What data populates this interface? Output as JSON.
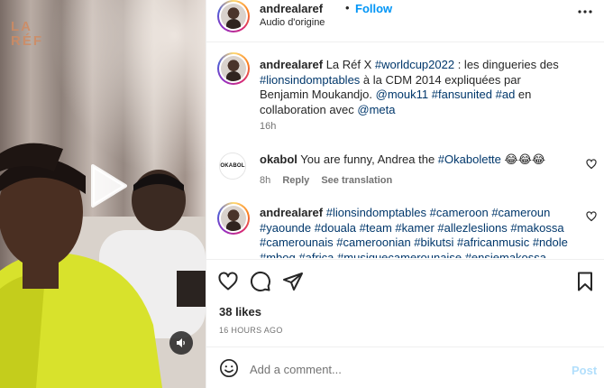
{
  "video": {
    "logo_line1": "LA",
    "logo_line2": "RÉF",
    "play_icon": "play-icon",
    "sound_icon": "speaker-icon"
  },
  "header": {
    "username": "andrealaref",
    "dot": "•",
    "follow_label": "Follow",
    "audio_label": "Audio d'origine",
    "more_icon": "more-horizontal-icon"
  },
  "caption": {
    "username": "andrealaref",
    "parts": [
      {
        "t": " La Réf X ",
        "tag": false
      },
      {
        "t": "#worldcup2022",
        "tag": true
      },
      {
        "t": " : les dingueries des ",
        "tag": false
      },
      {
        "t": "#lionsindomptables",
        "tag": true
      },
      {
        "t": " à la CDM 2014 expliquées par Benjamin Moukandjo. ",
        "tag": false
      },
      {
        "t": "@mouk11",
        "tag": true
      },
      {
        "t": " ",
        "tag": false
      },
      {
        "t": "#fansunited",
        "tag": true
      },
      {
        "t": " ",
        "tag": false
      },
      {
        "t": "#ad",
        "tag": true
      },
      {
        "t": " en collaboration avec ",
        "tag": false
      },
      {
        "t": "@meta",
        "tag": true
      }
    ],
    "time": "16h"
  },
  "comment1": {
    "avatar_text": "OKABOL",
    "username": "okabol",
    "parts": [
      {
        "t": " You are funny, Andrea the ",
        "tag": false
      },
      {
        "t": "#Okabolette",
        "tag": true
      },
      {
        "t": " 😂😂😂",
        "tag": false
      }
    ],
    "time": "8h",
    "reply": "Reply",
    "see_translation": "See translation"
  },
  "comment2": {
    "username": "andrealaref",
    "parts": [
      {
        "t": " ",
        "tag": false
      },
      {
        "t": "#lionsindomptables",
        "tag": true
      },
      {
        "t": " ",
        "tag": false
      },
      {
        "t": "#cameroon",
        "tag": true
      },
      {
        "t": " ",
        "tag": false
      },
      {
        "t": "#cameroun",
        "tag": true
      },
      {
        "t": " ",
        "tag": false
      },
      {
        "t": "#yaounde",
        "tag": true
      },
      {
        "t": " ",
        "tag": false
      },
      {
        "t": "#douala",
        "tag": true
      },
      {
        "t": " ",
        "tag": false
      },
      {
        "t": "#team",
        "tag": true
      },
      {
        "t": " ",
        "tag": false
      },
      {
        "t": "#kamer",
        "tag": true
      },
      {
        "t": " ",
        "tag": false
      },
      {
        "t": "#allezleslions",
        "tag": true
      },
      {
        "t": " ",
        "tag": false
      },
      {
        "t": "#makossa",
        "tag": true
      },
      {
        "t": " ",
        "tag": false
      },
      {
        "t": "#camerounais",
        "tag": true
      },
      {
        "t": " ",
        "tag": false
      },
      {
        "t": "#cameroonian",
        "tag": true
      },
      {
        "t": " ",
        "tag": false
      },
      {
        "t": "#bikutsi",
        "tag": true
      },
      {
        "t": " ",
        "tag": false
      },
      {
        "t": "#africanmusic",
        "tag": true
      },
      {
        "t": " ",
        "tag": false
      },
      {
        "t": "#ndole",
        "tag": true
      },
      {
        "t": " ",
        "tag": false
      },
      {
        "t": "#mbog",
        "tag": true
      },
      {
        "t": " ",
        "tag": false
      },
      {
        "t": "#africa",
        "tag": true
      },
      {
        "t": " ",
        "tag": false
      },
      {
        "t": "#musiquecamerounaise",
        "tag": true
      },
      {
        "t": " ",
        "tag": false
      },
      {
        "t": "#ensiemakossa",
        "tag": true
      }
    ]
  },
  "actions": {
    "like_icon": "heart-icon",
    "comment_icon": "comment-icon",
    "share_icon": "share-icon",
    "save_icon": "bookmark-icon"
  },
  "likes_text": "38 likes",
  "posted_ago": "16 HOURS AGO",
  "add_comment": {
    "placeholder": "Add a comment...",
    "post_label": "Post",
    "emoji_icon": "emoji-icon"
  },
  "colors": {
    "link": "#0095f6",
    "hashtag": "#00376b",
    "secondary_text": "#737373",
    "post_disabled": "#b2dffc"
  }
}
